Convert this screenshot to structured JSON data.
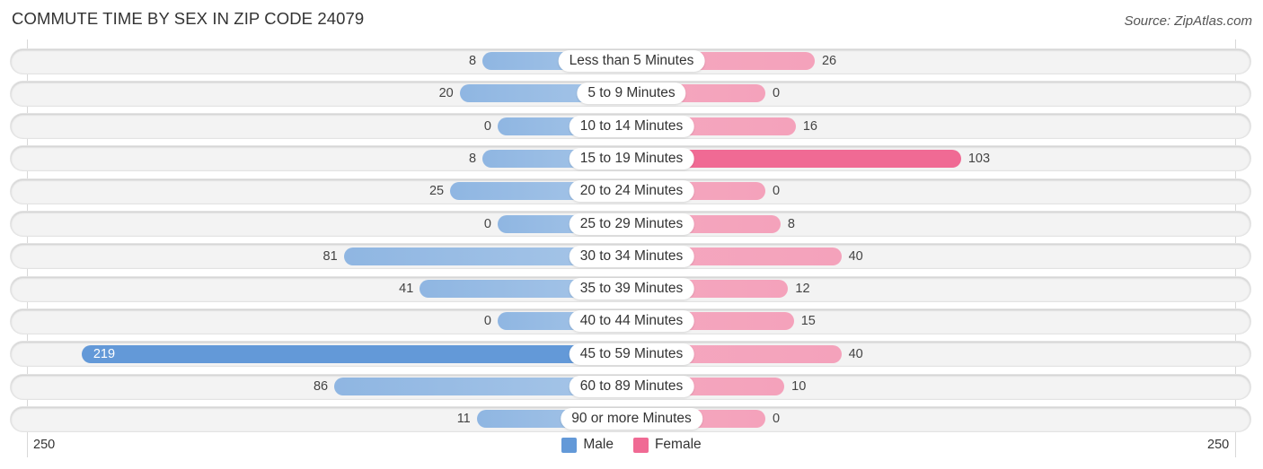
{
  "chart_data": {
    "type": "bar",
    "orientation": "horizontal-diverging",
    "title": "COMMUTE TIME BY SEX IN ZIP CODE 24079",
    "source": "Source: ZipAtlas.com",
    "categories": [
      "Less than 5 Minutes",
      "5 to 9 Minutes",
      "10 to 14 Minutes",
      "15 to 19 Minutes",
      "20 to 24 Minutes",
      "25 to 29 Minutes",
      "30 to 34 Minutes",
      "35 to 39 Minutes",
      "40 to 44 Minutes",
      "45 to 59 Minutes",
      "60 to 89 Minutes",
      "90 or more Minutes"
    ],
    "series": [
      {
        "name": "Male",
        "color": "#6399d8",
        "values": [
          8,
          20,
          0,
          8,
          25,
          0,
          81,
          41,
          0,
          219,
          86,
          11
        ]
      },
      {
        "name": "Female",
        "color": "#f06a94",
        "values": [
          26,
          0,
          16,
          103,
          0,
          8,
          40,
          12,
          15,
          40,
          10,
          0
        ]
      }
    ],
    "axis": {
      "left_tick": "250",
      "right_tick": "250",
      "range": [
        -250,
        250
      ]
    },
    "legend": {
      "position": "bottom-center",
      "items": [
        "Male",
        "Female"
      ]
    }
  }
}
